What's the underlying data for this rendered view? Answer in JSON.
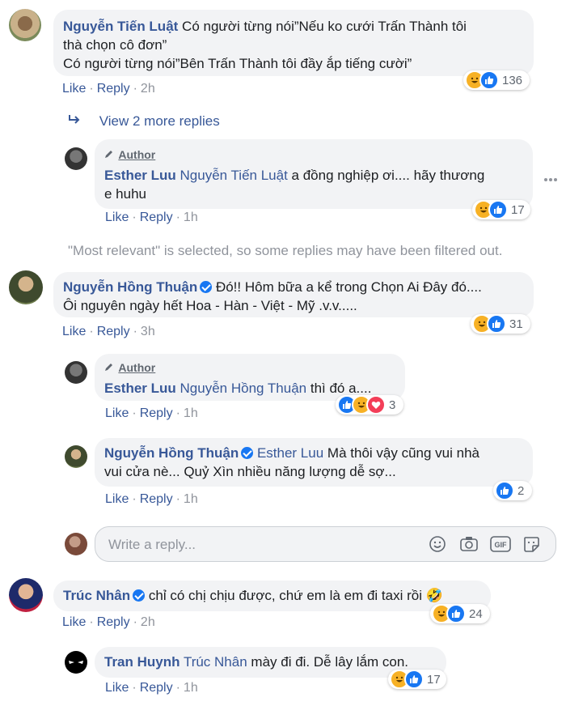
{
  "comments": [
    {
      "author": "Nguyễn Tiến Luật",
      "text_line1": "Có người từng nói”Nếu ko cưới Trấn Thành tôi",
      "text_line2": "thà chọn cô đơn”",
      "text_line3": "Có người từng nói”Bên Trấn Thành tôi đầy ắp tiếng cười”",
      "like": "Like",
      "reply": "Reply",
      "time": "2h",
      "reaction_count": "136"
    },
    {
      "view_more": "View 2 more replies"
    },
    {
      "author_badge": "Author",
      "author": "Esther Luu",
      "tag": "Nguyễn Tiến Luật",
      "text_line1": "a đồng nghiệp ơi.... hãy thương",
      "text_line2": "e huhu",
      "like": "Like",
      "reply": "Reply",
      "time": "1h",
      "reaction_count": "17"
    },
    {
      "notice": "\"Most relevant\" is selected, so some replies may have been filtered out."
    },
    {
      "author": "Nguyễn Hồng Thuận",
      "text_line1": "Đó!! Hôm bữa a kể trong Chọn Ai Đây đó....",
      "text_line2": "Ôi nguyên ngày hết Hoa - Hàn - Việt - Mỹ .v.v.....",
      "like": "Like",
      "reply": "Reply",
      "time": "3h",
      "reaction_count": "31"
    },
    {
      "author_badge": "Author",
      "author": "Esther Luu",
      "tag": "Nguyễn Hồng Thuận",
      "text_line1": "thì đó a....",
      "like": "Like",
      "reply": "Reply",
      "time": "1h",
      "reaction_count": "3"
    },
    {
      "author": "Nguyễn Hồng Thuận",
      "tag": "Esther Luu",
      "text_line1": "Mà thôi vậy cũng vui nhà",
      "text_line2": "vui cửa nè... Quỷ Xìn nhiều năng lượng dễ sợ...",
      "like": "Like",
      "reply": "Reply",
      "time": "1h",
      "reaction_count": "2"
    },
    {
      "reply_placeholder": "Write a reply..."
    },
    {
      "author": "Trúc Nhân",
      "text_line1": "chỉ có chị chịu được, chứ em là em đi taxi rồi 🤣",
      "like": "Like",
      "reply": "Reply",
      "time": "2h",
      "reaction_count": "24"
    },
    {
      "author": "Tran Huynh",
      "tag": "Trúc Nhân",
      "text_line1": "mày đi đi. Dễ lây lắm con.",
      "like": "Like",
      "reply": "Reply",
      "time": "1h",
      "reaction_count": "17"
    }
  ],
  "colors": {
    "link": "#385898",
    "bubble": "#f2f3f5",
    "like_blue": "#1877f2",
    "haha_yellow": "#f7b125",
    "love_red": "#f33e58"
  },
  "icons": [
    "reply-arrow-icon",
    "pencil-icon",
    "more-icon",
    "emoji-icon",
    "camera-icon",
    "gif-icon",
    "sticker-icon",
    "verified-icon",
    "haha-icon",
    "like-icon",
    "love-icon"
  ]
}
